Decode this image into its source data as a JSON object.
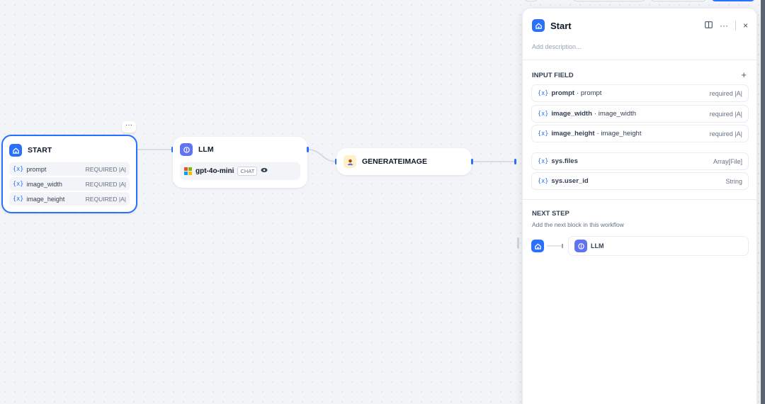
{
  "canvas": {
    "start_node": {
      "title": "START",
      "variables": [
        {
          "brace": "{x}",
          "name": "prompt",
          "tag": "REQUIRED |A|"
        },
        {
          "brace": "{x}",
          "name": "image_width",
          "tag": "REQUIRED |A|"
        },
        {
          "brace": "{x}",
          "name": "image_height",
          "tag": "REQUIRED |A|"
        }
      ],
      "more_label": "···"
    },
    "llm_node": {
      "title": "LLM",
      "model": "gpt-4o-mini",
      "mode_badge": "CHAT"
    },
    "generate_node": {
      "title": "GENERATEIMAGE"
    }
  },
  "panel": {
    "title": "Start",
    "description_placeholder": "Add description...",
    "input_section_title": "INPUT FIELD",
    "input_fields": [
      {
        "brace": "{x}",
        "name": "prompt",
        "label": "· prompt",
        "meta": "required |A|"
      },
      {
        "brace": "{x}",
        "name": "image_width",
        "label": "· image_width",
        "meta": "required |A|"
      },
      {
        "brace": "{x}",
        "name": "image_height",
        "label": "· image_height",
        "meta": "required |A|"
      }
    ],
    "system_fields": [
      {
        "brace": "{x}",
        "name": "sys.files",
        "meta": "Array[File]"
      },
      {
        "brace": "{x}",
        "name": "sys.user_id",
        "meta": "String"
      }
    ],
    "next_step_title": "NEXT STEP",
    "next_step_subtitle": "Add the next block in this workflow",
    "next_block_label": "LLM",
    "actions": {
      "more": "···",
      "close": "×",
      "plus": "+"
    }
  },
  "colors": {
    "accent": "#2970ff",
    "llm_icon": "#6172f3"
  }
}
